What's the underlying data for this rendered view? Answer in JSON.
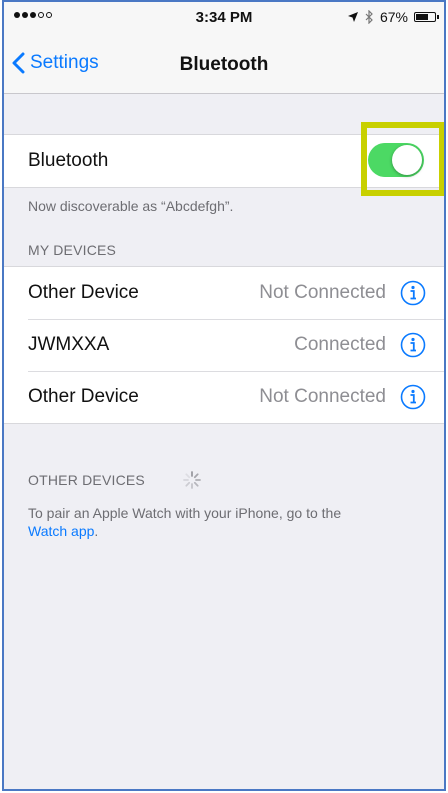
{
  "status_bar": {
    "time": "3:34 PM",
    "battery_percent": "67%",
    "battery_level": 0.67,
    "signal_bars_filled": 3,
    "signal_bars_total": 5
  },
  "nav": {
    "back_label": "Settings",
    "title": "Bluetooth"
  },
  "bluetooth_toggle": {
    "label": "Bluetooth",
    "on": true,
    "on_color": "#4cd964"
  },
  "discoverable_text": "Now discoverable as “Abcdefgh”.",
  "my_devices": {
    "header": "MY DEVICES",
    "devices": [
      {
        "name": "Other Device",
        "status": "Not Connected"
      },
      {
        "name": "JWMXXA",
        "status": "Connected"
      },
      {
        "name": "Other Device",
        "status": "Not Connected"
      }
    ]
  },
  "other_devices": {
    "header": "OTHER DEVICES",
    "note": "To pair an Apple Watch with your iPhone, go to the",
    "link": "Watch app",
    "note_end": "."
  },
  "colors": {
    "accent": "#0a7aff",
    "highlight": "#c8d000",
    "background": "#efeff4"
  }
}
